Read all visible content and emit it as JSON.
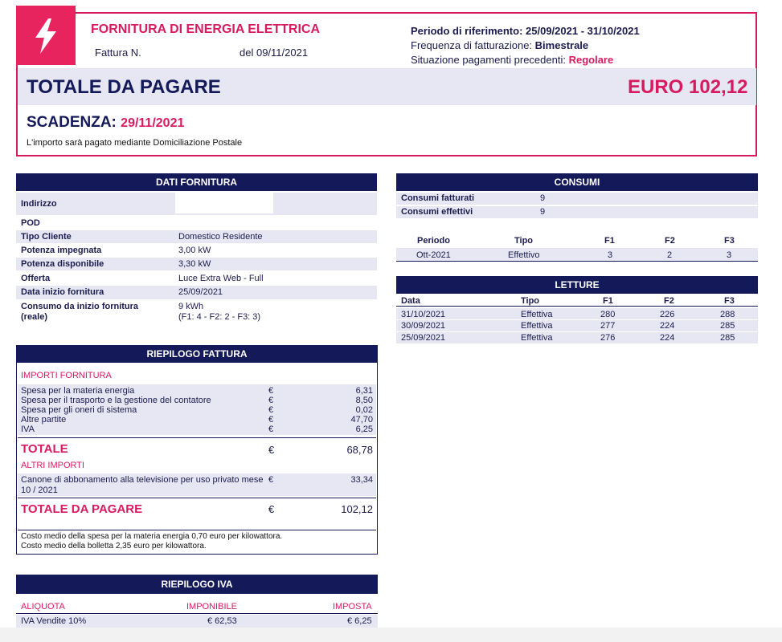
{
  "header": {
    "title": "FORNITURA DI ENERGIA ELETTRICA",
    "invoice_label": "Fattura N.",
    "date_label": "del 09/11/2021",
    "period": "Periodo di riferimento: 25/09/2021 - 31/10/2021",
    "freq_label": "Frequenza di fatturazione:",
    "freq_value": "Bimestrale",
    "payments_label": "Situazione pagamenti precedenti:",
    "payments_value": "Regolare",
    "total_label": "TOTALE DA PAGARE",
    "total_value": "EURO 102,12",
    "due_label": "SCADENZA:",
    "due_value": "29/11/2021",
    "payment_note": "L'importo sarà pagato mediante Domiciliazione Postale",
    "logo_icon": "lightning-bolt-icon",
    "accent": "#d81b60",
    "navy": "#14195a"
  },
  "dati_fornitura": {
    "title": "DATI FORNITURA",
    "rows": [
      {
        "label": "Indirizzo",
        "value": ""
      },
      {
        "label": "POD",
        "value": ""
      },
      {
        "label": "Tipo Cliente",
        "value": "Domestico Residente"
      },
      {
        "label": "Potenza impegnata",
        "value": "3,00 kW"
      },
      {
        "label": "Potenza disponibile",
        "value": "3,30 kW"
      },
      {
        "label": "Offerta",
        "value": "Luce Extra Web - Full"
      },
      {
        "label": "Data inizio fornitura",
        "value": "25/09/2021"
      }
    ],
    "consumo_label_1": "Consumo da inizio fornitura",
    "consumo_label_2": "(reale)",
    "consumo_value_1": "9 kWh",
    "consumo_value_2": "(F1: 4 - F2: 2 - F3: 3)"
  },
  "consumi": {
    "title": "CONSUMI",
    "fatturati_label": "Consumi fatturati",
    "fatturati_value": "9",
    "effettivi_label": "Consumi effettivi",
    "effettivi_value": "9",
    "headers": [
      "Periodo",
      "Tipo",
      "F1",
      "F2",
      "F3"
    ],
    "row": [
      "Ott-2021",
      "Effettivo",
      "3",
      "2",
      "3"
    ]
  },
  "letture": {
    "title": "LETTURE",
    "headers": [
      "Data",
      "Tipo",
      "F1",
      "F2",
      "F3"
    ],
    "rows": [
      [
        "31/10/2021",
        "Effettiva",
        "280",
        "226",
        "288"
      ],
      [
        "30/09/2021",
        "Effettiva",
        "277",
        "224",
        "285"
      ],
      [
        "25/09/2021",
        "Effettiva",
        "276",
        "224",
        "285"
      ]
    ]
  },
  "riepilogo_fattura": {
    "title": "RIEPILOGO FATTURA",
    "importi_label": "IMPORTI FORNITURA",
    "currency": "€",
    "items": [
      {
        "label": "Spesa per la materia energia",
        "value": "6,31"
      },
      {
        "label": "Spesa per il trasporto e la gestione del contatore",
        "value": "8,50"
      },
      {
        "label": "Spesa per gli oneri di sistema",
        "value": "0,02"
      },
      {
        "label": "Altre partite",
        "value": "47,70"
      },
      {
        "label": "IVA",
        "value": "6,25"
      }
    ],
    "totale_label": "TOTALE",
    "totale_value": "68,78",
    "altri_label": "ALTRI IMPORTI",
    "canone_label_1": "Canone di abbonamento alla televisione per uso privato mese",
    "canone_label_2": "10 / 2021",
    "canone_value": "33,34",
    "totale_pagare_label": "TOTALE DA PAGARE",
    "totale_pagare_value": "102,12",
    "note_1": "Costo medio della spesa per la materia energia 0,70 euro per kilowattora.",
    "note_2": "Costo medio della bolletta 2,35 euro per kilowattora."
  },
  "riepilogo_iva": {
    "title": "RIEPILOGO IVA",
    "headers": [
      "ALIQUOTA",
      "IMPONIBILE",
      "IMPOSTA"
    ],
    "row": [
      "IVA Vendite 10%",
      "€ 62,53",
      "€ 6,25"
    ]
  }
}
